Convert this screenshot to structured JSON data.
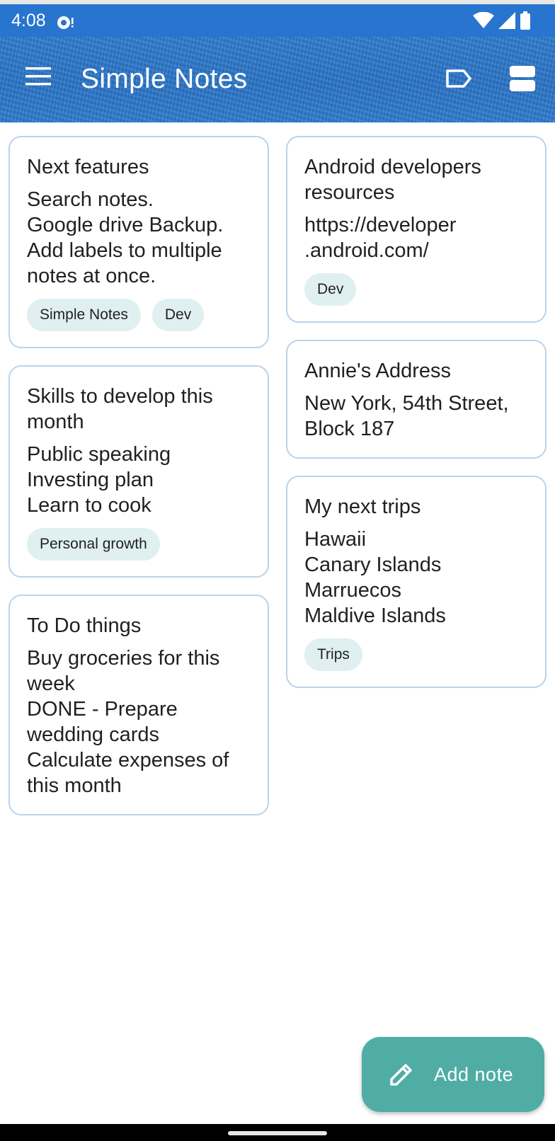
{
  "status_bar": {
    "time": "4:08"
  },
  "app_bar": {
    "title": "Simple Notes"
  },
  "columns": {
    "left": [
      {
        "title": "Next features",
        "body": "Search notes.\nGoogle drive Backup.\nAdd labels to multiple notes at once.",
        "tags": [
          "Simple Notes",
          "Dev"
        ]
      },
      {
        "title": "Skills to develop this month",
        "body": "Public speaking\nInvesting plan\nLearn to cook",
        "tags": [
          "Personal growth"
        ]
      },
      {
        "title": "To Do things",
        "body": "Buy groceries for this week\nDONE - Prepare wedding cards\nCalculate expenses of this month",
        "tags": []
      }
    ],
    "right": [
      {
        "title": "Android developers resources",
        "body": "https://developer\n.android.com/",
        "tags": [
          "Dev"
        ]
      },
      {
        "title": "Annie's Address",
        "body": "New York, 54th Street, Block 187",
        "tags": []
      },
      {
        "title": "My next trips",
        "body": "Hawaii\nCanary Islands\nMarruecos\nMaldive Islands",
        "tags": [
          "Trips"
        ]
      }
    ]
  },
  "fab": {
    "label": "Add note"
  },
  "colors": {
    "app_bar": "#2a74c7",
    "card_border": "#b8d3ee",
    "tag_bg": "#e0f0f0",
    "fab": "#4fada6"
  },
  "icons": [
    "menu-icon",
    "label-icon",
    "view-layout-icon",
    "pencil-icon",
    "wifi-icon",
    "cell-signal-icon",
    "battery-icon"
  ]
}
